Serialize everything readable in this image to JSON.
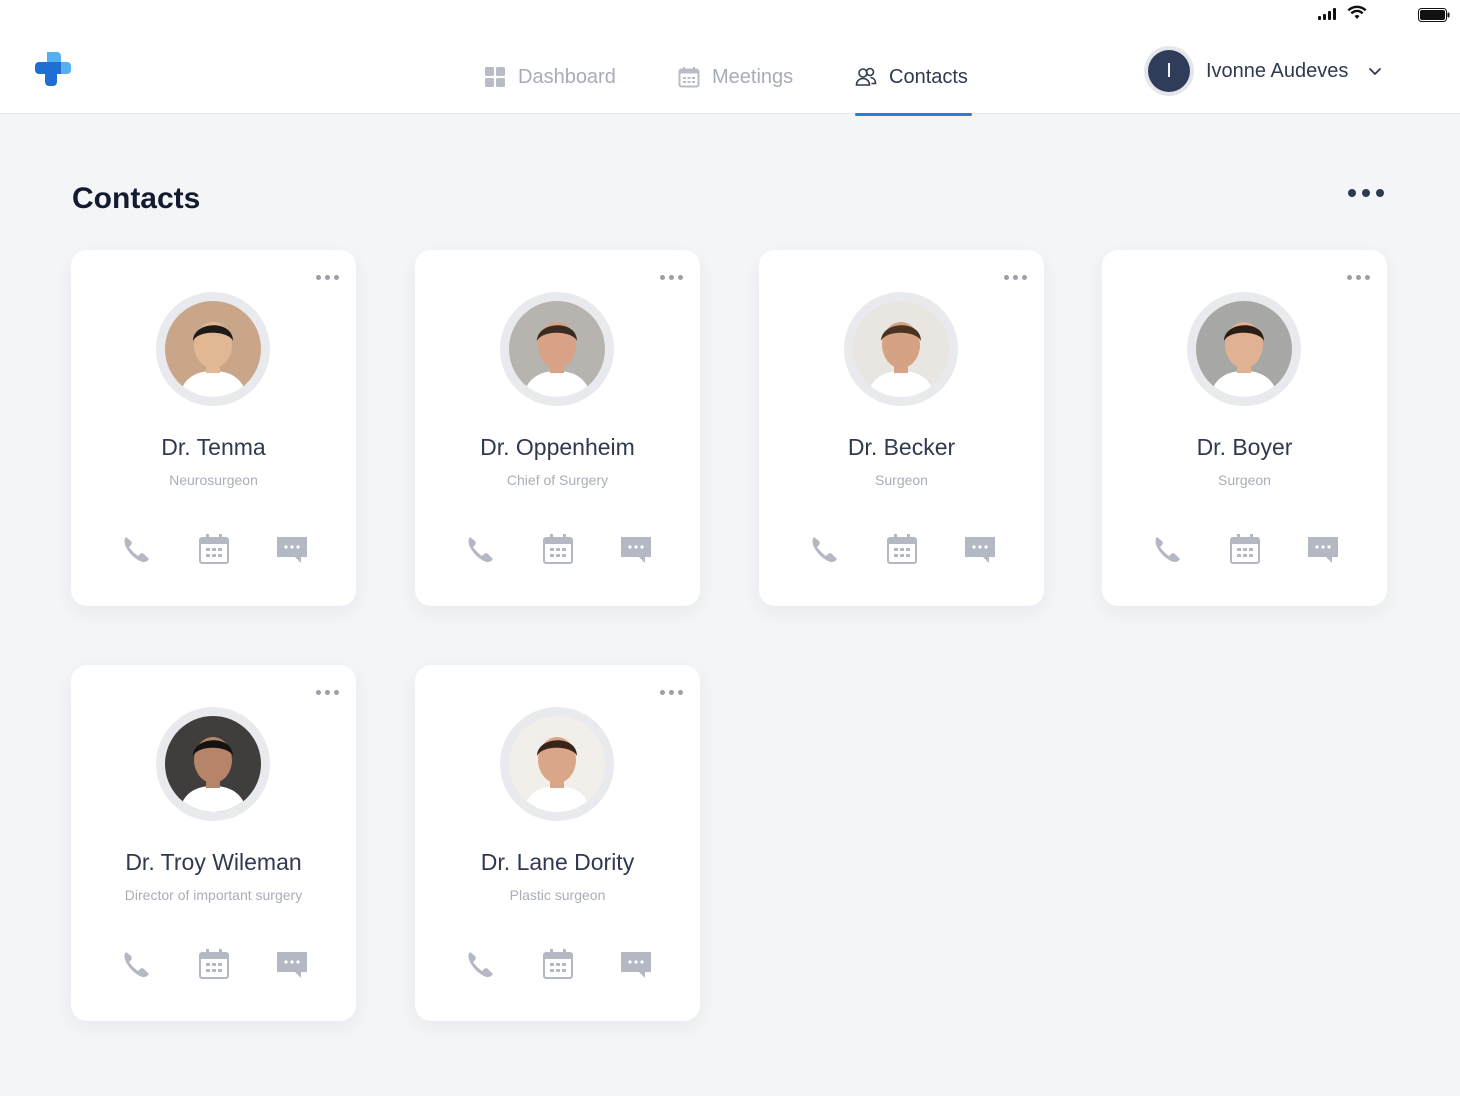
{
  "nav": {
    "items": [
      {
        "label": "Dashboard",
        "icon": "dashboard-icon",
        "active": false
      },
      {
        "label": "Meetings",
        "icon": "calendar-icon",
        "active": false
      },
      {
        "label": "Contacts",
        "icon": "contacts-icon",
        "active": true
      }
    ]
  },
  "user": {
    "initial": "I",
    "name": "Ivonne Audeves"
  },
  "page": {
    "title": "Contacts"
  },
  "colors": {
    "accent": "#2e7bd6",
    "logo_light": "#4aa3f0",
    "logo_dark": "#1d6fd1",
    "avatar_bg": "#2f3d5b"
  },
  "contacts": [
    {
      "name": "Dr. Tenma",
      "role": "Neurosurgeon",
      "photo_bg": "#c9a58a",
      "skin": "#e2b894",
      "hair": "#1d1b1a"
    },
    {
      "name": "Dr. Oppenheim",
      "role": "Chief of Surgery",
      "photo_bg": "#b7b3ae",
      "skin": "#d9a287",
      "hair": "#3a2b22"
    },
    {
      "name": "Dr. Becker",
      "role": "Surgeon",
      "photo_bg": "#e9e5e0",
      "skin": "#d5a283",
      "hair": "#4a3222"
    },
    {
      "name": "Dr. Boyer",
      "role": "Surgeon",
      "photo_bg": "#a7a7a5",
      "skin": "#e0b193",
      "hair": "#2a1d16"
    },
    {
      "name": "Dr. Troy Wileman",
      "role": "Director of important surgery",
      "photo_bg": "#3f3e3c",
      "skin": "#b58469",
      "hair": "#141312"
    },
    {
      "name": "Dr. Lane Dority",
      "role": "Plastic surgeon",
      "photo_bg": "#f2efea",
      "skin": "#d9a688",
      "hair": "#3a241a"
    }
  ]
}
